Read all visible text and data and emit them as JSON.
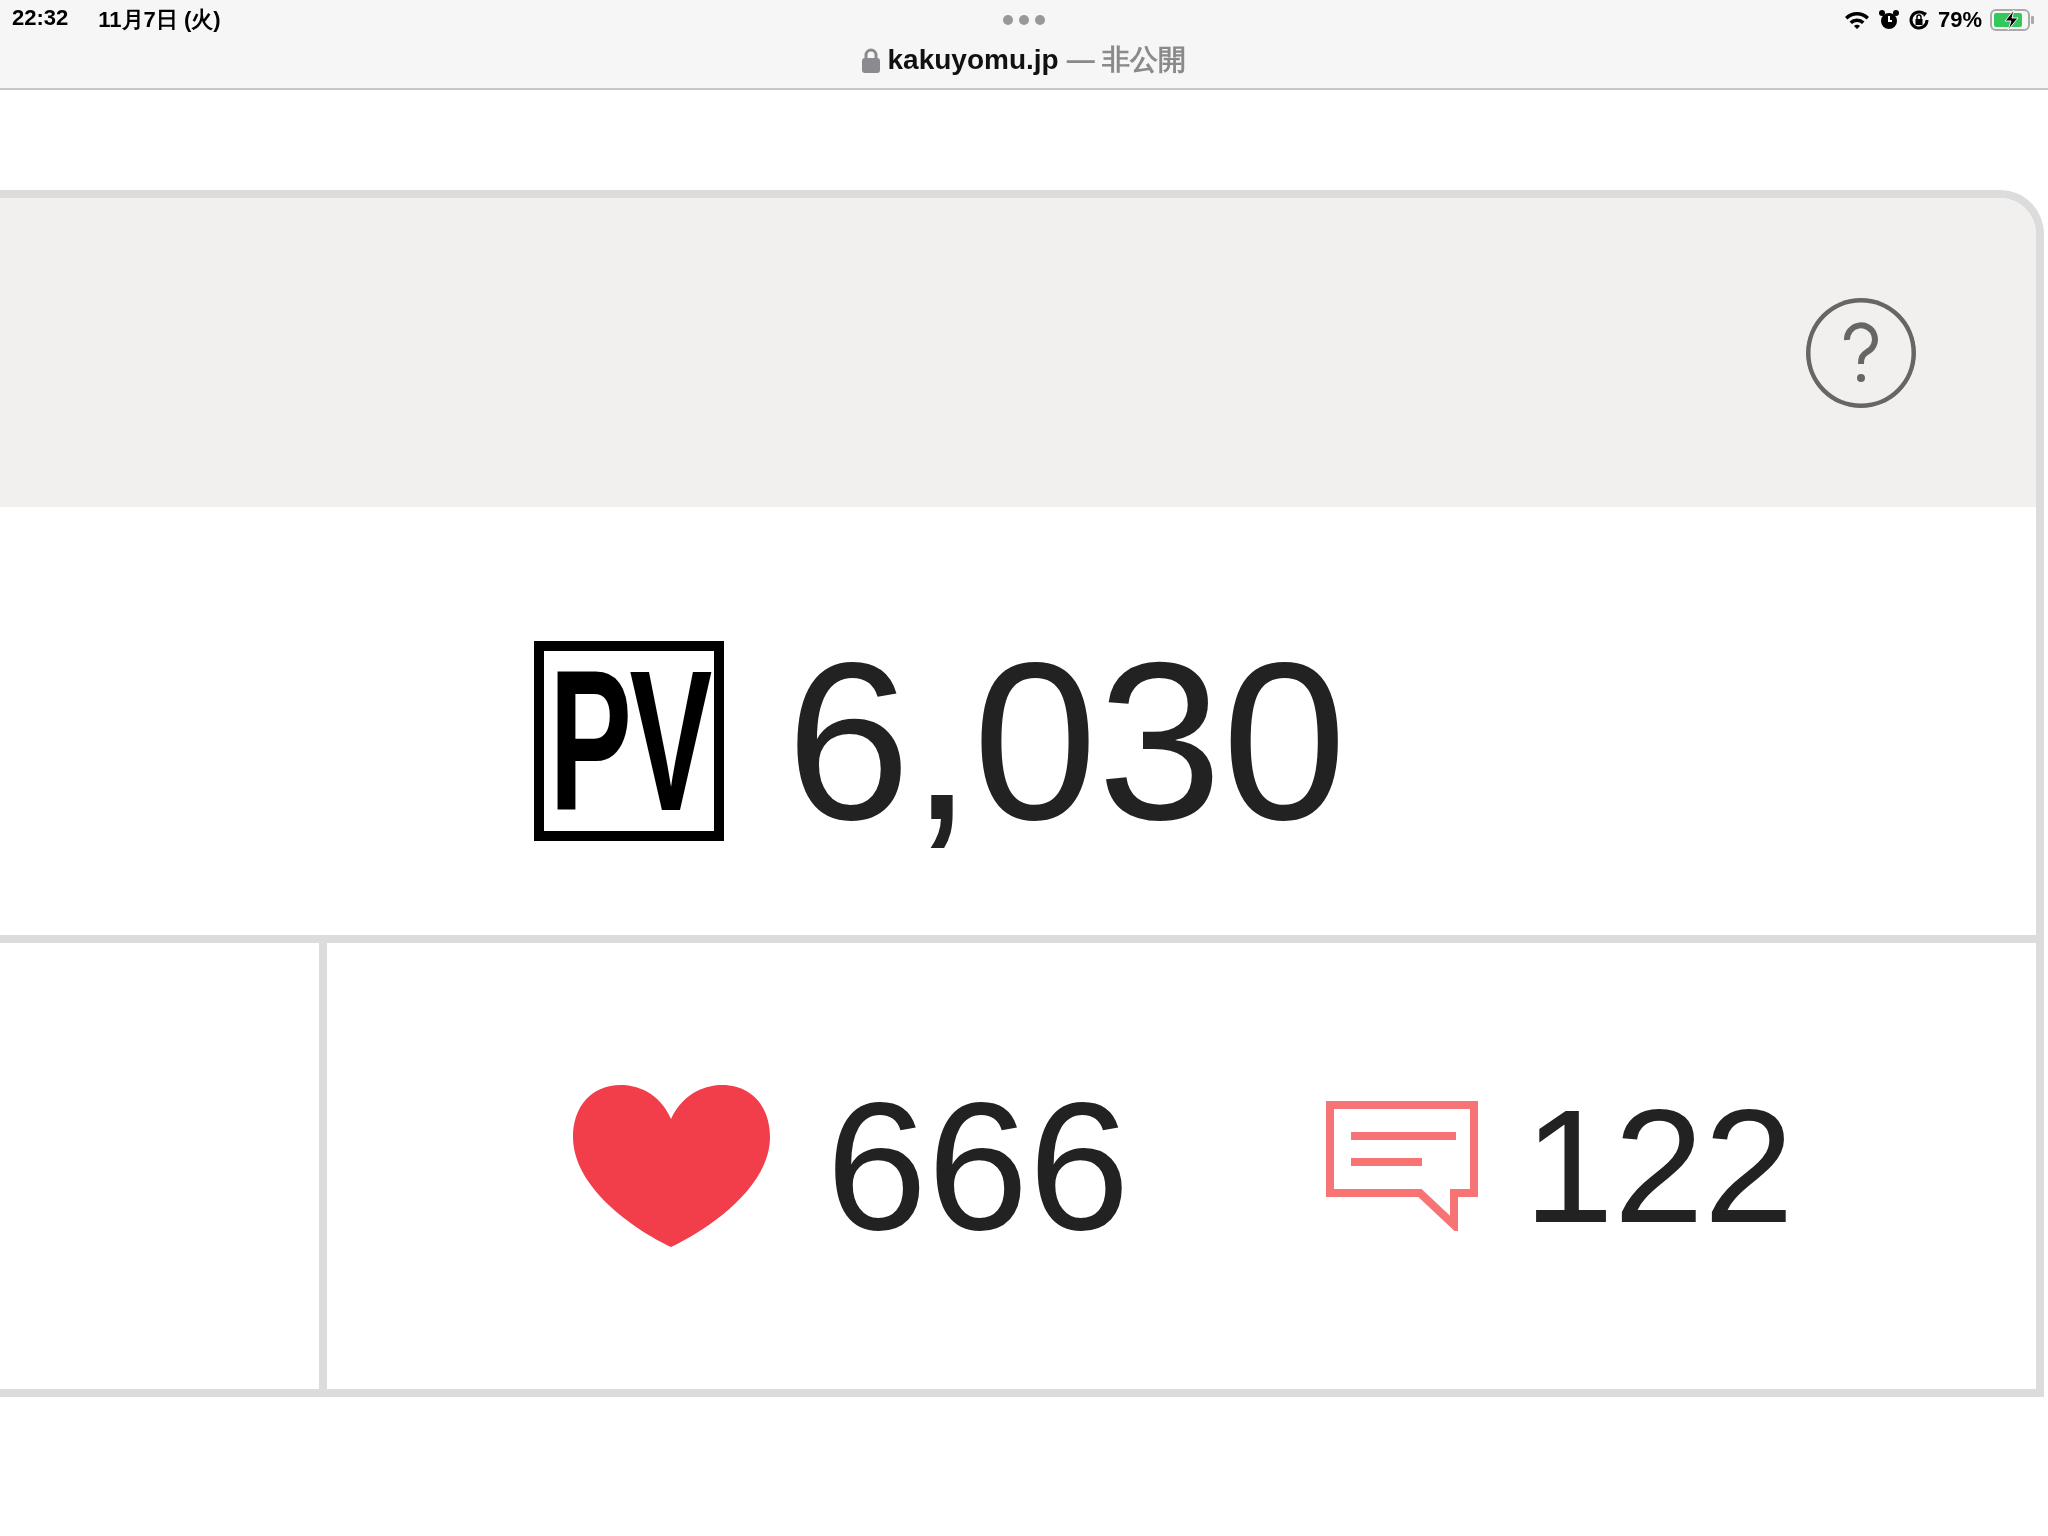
{
  "status_bar": {
    "time": "22:32",
    "date": "11月7日 (火)",
    "battery": "79%"
  },
  "address_bar": {
    "domain": "kakuyomu.jp",
    "status": "— 非公開"
  },
  "card": {
    "pv": {
      "label": "PV",
      "value": "6,030"
    },
    "likes": "666",
    "comments": "122"
  }
}
